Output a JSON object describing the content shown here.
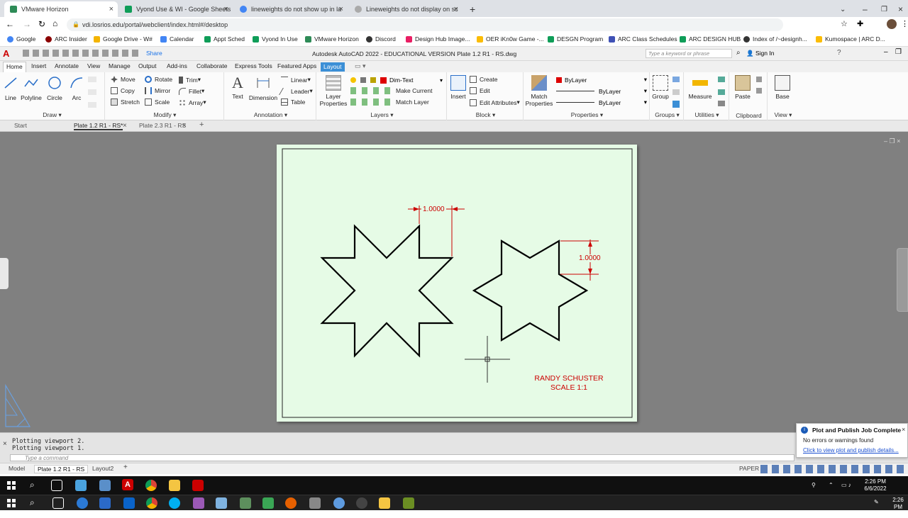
{
  "browser": {
    "tabs": [
      {
        "title": "VMware Horizon",
        "active": true
      },
      {
        "title": "Vyond Use & WI - Google Sheets"
      },
      {
        "title": "lineweights do not show up in la"
      },
      {
        "title": "Lineweights do not display on sc"
      }
    ],
    "new_tab": "+",
    "url": "vdi.losrios.edu/portal/webclient/index.html#/desktop",
    "bookmarks": [
      "Google",
      "ARC Insider",
      "Google Drive - W#",
      "Calendar",
      "Appt Sched",
      "Vyond In Use",
      "VMware Horizon",
      "Discord",
      "Design Hub Image...",
      "OER iKn0w Game -...",
      "DESGN Program",
      "ARC Class Schedules",
      "ARC DESIGN HUB",
      "Index of /~designh...",
      "Kumospace | ARC D..."
    ]
  },
  "acad": {
    "title": "Autodesk AutoCAD 2022 - EDUCATIONAL VERSION   Plate 1.2 R1 - RS.dwg",
    "share": "Share",
    "search_placeholder": "Type a keyword or phrase",
    "sign_in": "Sign In",
    "ribbon_tabs": [
      "Home",
      "Insert",
      "Annotate",
      "View",
      "Manage",
      "Output",
      "Add-ins",
      "Collaborate",
      "Express Tools",
      "Featured Apps",
      "Layout"
    ],
    "panels": {
      "draw": {
        "title": "Draw",
        "tools": [
          "Line",
          "Polyline",
          "Circle",
          "Arc"
        ]
      },
      "modify": {
        "title": "Modify",
        "tools": [
          "Move",
          "Rotate",
          "Trim",
          "Copy",
          "Mirror",
          "Fillet",
          "Stretch",
          "Scale",
          "Array"
        ]
      },
      "annotation": {
        "title": "Annotation",
        "tools": [
          "Text",
          "Dimension",
          "Linear",
          "Leader",
          "Table"
        ]
      },
      "layers": {
        "title": "Layers",
        "tools": [
          "Layer Properties",
          "Make Current",
          "Match Layer"
        ],
        "current_layer": "Dim-Text"
      },
      "block": {
        "title": "Block",
        "tools": [
          "Insert",
          "Create",
          "Edit",
          "Edit Attributes"
        ]
      },
      "properties": {
        "title": "Properties",
        "tools": [
          "Match Properties"
        ],
        "color": "ByLayer",
        "linetype": "ByLayer",
        "lineweight": "ByLayer"
      },
      "groups": {
        "title": "Groups",
        "tools": [
          "Group"
        ]
      },
      "utilities": {
        "title": "Utilities",
        "tools": [
          "Measure"
        ]
      },
      "clipboard": {
        "title": "Clipboard",
        "tools": [
          "Paste"
        ]
      },
      "view": {
        "title": "View",
        "tools": [
          "Base"
        ]
      }
    },
    "doc_tabs": [
      "Start",
      "Plate 1.2 R1 - RS*",
      "Plate 2.3 R1 - RS"
    ],
    "drawing": {
      "dim_top": "1.0000",
      "dim_right": "1.0000",
      "label_line1": "RANDY SCHUSTER",
      "label_line2": "SCALE  1:1"
    },
    "command_history": [
      "Plotting viewport 2.",
      "Plotting viewport 1."
    ],
    "command_placeholder": "Type a command",
    "layout_tabs": [
      "Model",
      "Plate 1.2 R1 - RS",
      "Layout2"
    ],
    "status_paper": "PAPER",
    "notification": {
      "title": "Plot and Publish Job Complete",
      "body": "No errors or warnings found",
      "link": "Click to view plot and publish details..."
    }
  },
  "taskbar": {
    "time": "2:26 PM",
    "date": "6/6/2022"
  },
  "colors": {
    "accent": "#3b8fd6",
    "paper": "#e6fbe6",
    "dim": "#cc0000",
    "canvas": "#808080"
  }
}
